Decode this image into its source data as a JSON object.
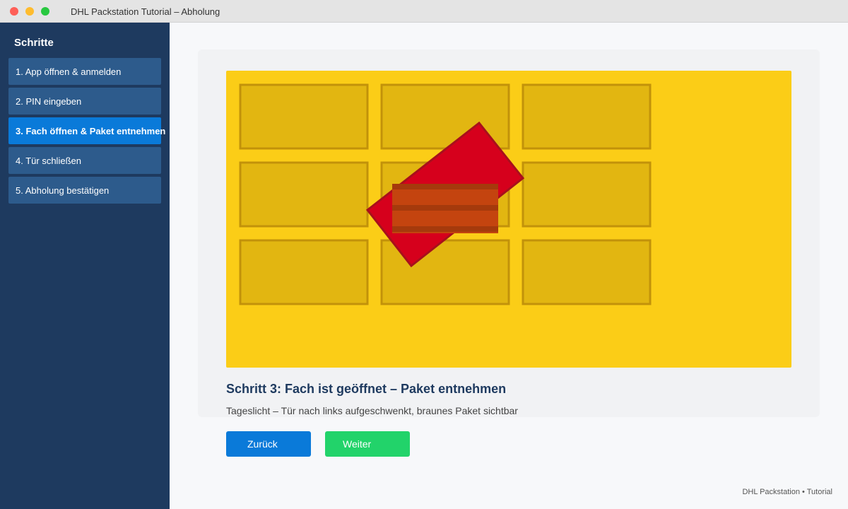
{
  "window": {
    "title": "DHL Packstation Tutorial – Abholung"
  },
  "sidebar": {
    "title": "Schritte",
    "items": [
      {
        "label": "1. App öffnen & anmelden",
        "active": false
      },
      {
        "label": "2. PIN eingeben",
        "active": false
      },
      {
        "label": "3. Fach öffnen & Paket entnehmen",
        "active": true
      },
      {
        "label": "4. Tür schließen",
        "active": false
      },
      {
        "label": "5. Abholung bestätigen",
        "active": false
      }
    ]
  },
  "main": {
    "heading": "Schritt 3: Fach ist geöffnet – Paket entnehmen",
    "description": "Tageslicht – Tür nach links aufgeschwenkt, braunes Paket sichtbar"
  },
  "buttons": {
    "back": "Zurück",
    "next": "Weiter"
  },
  "footer": {
    "text": "DHL Packstation • Tutorial"
  },
  "colors": {
    "sidebar_bg": "#1e3a5f",
    "item_bg": "#2d5b8c",
    "active_item": "#0a7ad9",
    "next_button": "#22d36a",
    "packstation_yellow": "#fbcd17",
    "locker_door": "#e2b611",
    "open_door_red": "#d6001c",
    "parcel_brown": "#c4440f"
  }
}
